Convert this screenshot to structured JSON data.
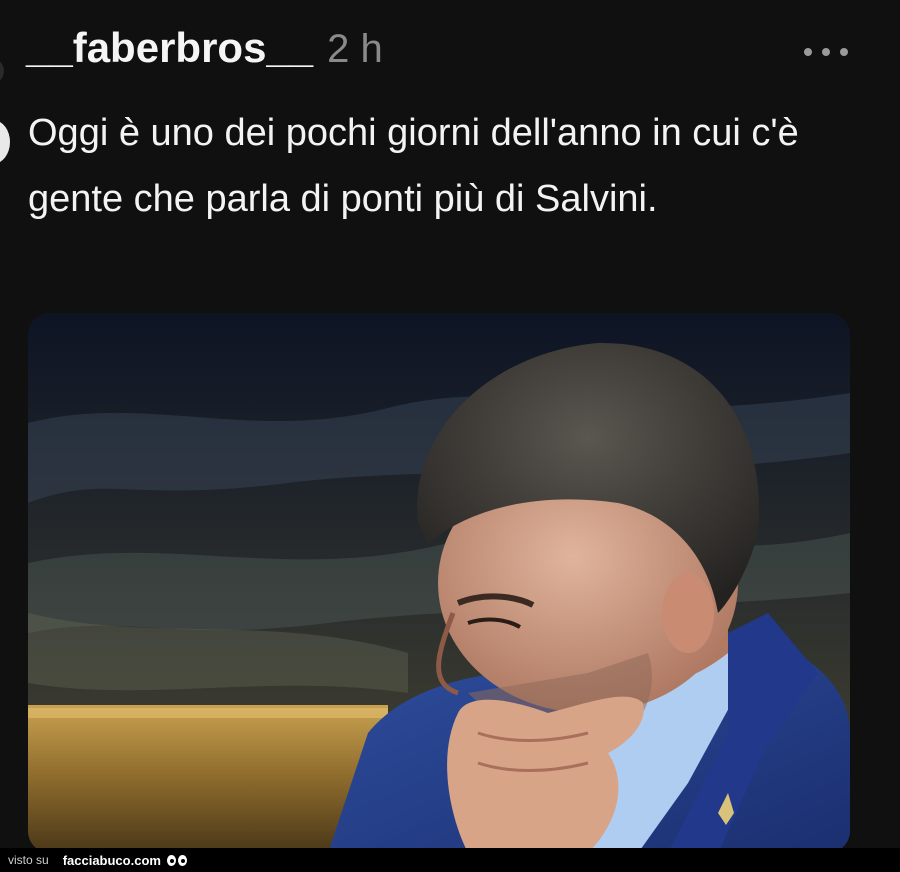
{
  "post": {
    "username": "__faberbros__",
    "timestamp": "2 h",
    "text": "Oggi è uno dei pochi giorni dell'anno in cui c'è gente che parla di ponti più di Salvini.",
    "more_icon": "more-horizontal-icon"
  },
  "footer": {
    "visto_label": "visto su",
    "brand": "facciabuco.com",
    "brand_icon": "eyes-icon"
  },
  "colors": {
    "background": "#101010",
    "text": "#f3f3f3",
    "muted": "#8a8a8a"
  }
}
